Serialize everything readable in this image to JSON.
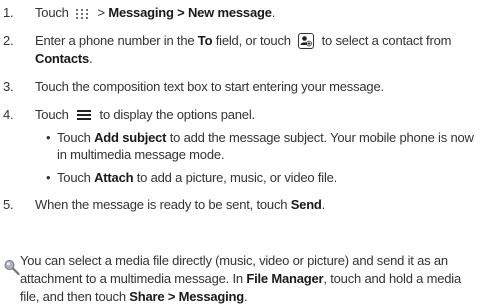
{
  "steps": [
    {
      "num": "1.",
      "lead": "Touch",
      "path_a": "> ",
      "app": "Messaging",
      "sep": " > ",
      "action": "New message",
      "end": "."
    },
    {
      "num": "2.",
      "t1": "Enter a phone number in the ",
      "field": "To",
      "t2": " field, or touch",
      "t3": "to select a contact from",
      "contacts": "Contacts",
      "end": "."
    },
    {
      "num": "3.",
      "text": "Touch the composition text box to start entering your message."
    },
    {
      "num": "4.",
      "lead": "Touch",
      "text": "to display the options panel.",
      "bullets": [
        {
          "pre": "Touch ",
          "bold": "Add subject",
          "post": " to add the message subject. Your mobile phone is now",
          "cont": "in multimedia message mode."
        },
        {
          "pre": "Touch ",
          "bold": "Attach",
          "post": " to add a picture, music, or video file."
        }
      ]
    },
    {
      "num": "5.",
      "pre": "When the message is ready to be sent, touch ",
      "bold": "Send",
      "end": "."
    }
  ],
  "note": {
    "line1": "You can select a media file directly (music, video or picture) and send it as an",
    "line2_pre": "attachment to a multimedia message. In ",
    "file_manager": "File Manager",
    "line2_post": ", touch and hold a media",
    "line3_pre": "file, and then touch ",
    "share": "Share",
    "sep": " > ",
    "messaging": "Messaging",
    "end": "."
  },
  "icons": {
    "apps_grid": "apps-grid-icon",
    "contact_picker": "add-contact-icon",
    "menu": "menu-icon",
    "note": "tip-icon"
  }
}
